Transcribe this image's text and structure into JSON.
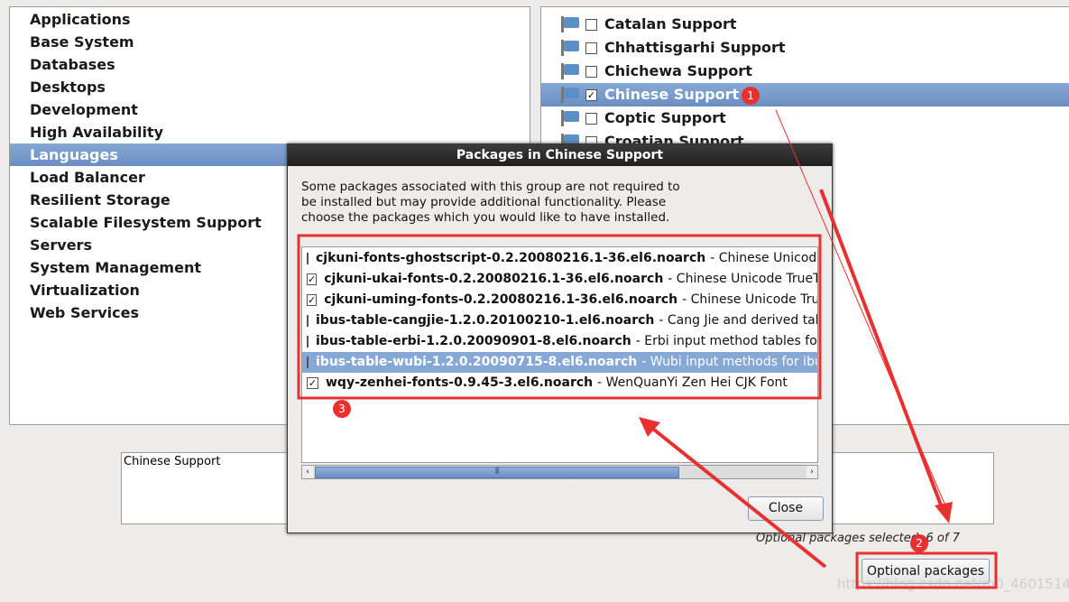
{
  "groups": [
    "Applications",
    "Base System",
    "Databases",
    "Desktops",
    "Development",
    "High Availability",
    "Languages",
    "Load Balancer",
    "Resilient Storage",
    "Scalable Filesystem Support",
    "Servers",
    "System Management",
    "Virtualization",
    "Web Services"
  ],
  "selected_group": "Languages",
  "languages": [
    {
      "label": "Catalan Support",
      "checked": false
    },
    {
      "label": "Chhattisgarhi Support",
      "checked": false
    },
    {
      "label": "Chichewa Support",
      "checked": false
    },
    {
      "label": "Chinese Support",
      "checked": true,
      "selected": true
    },
    {
      "label": "Coptic Support",
      "checked": false
    },
    {
      "label": "Croatian Support",
      "checked": false
    }
  ],
  "description": "Chinese Support",
  "count_text": "Optional packages selected: 6 of 7",
  "optional_button": "Optional packages",
  "dialog": {
    "title": "Packages in Chinese Support",
    "text": "Some packages associated with this group are not required to be installed but may provide additional functionality. Please choose the packages which you would like to have installed.",
    "close": "Close",
    "packages": [
      {
        "name": "cjkuni-fonts-ghostscript-0.2.20080216.1-36.el6.noarch",
        "desc": "- Chinese Unicode TrueType fonts",
        "checked": false
      },
      {
        "name": "cjkuni-ukai-fonts-0.2.20080216.1-36.el6.noarch",
        "desc": "- Chinese Unicode TrueType fonts",
        "checked": true
      },
      {
        "name": "cjkuni-uming-fonts-0.2.20080216.1-36.el6.noarch",
        "desc": "- Chinese Unicode TrueType fonts",
        "checked": true
      },
      {
        "name": "ibus-table-cangjie-1.2.0.20100210-1.el6.noarch",
        "desc": "- Cang Jie and derived tables",
        "checked": false
      },
      {
        "name": "ibus-table-erbi-1.2.0.20090901-8.el6.noarch",
        "desc": "- Erbi input method tables for IBus",
        "checked": false
      },
      {
        "name": "ibus-table-wubi-1.2.0.20090715-8.el6.noarch",
        "desc": "- Wubi input methods for ibus-table",
        "checked": false,
        "selected": true
      },
      {
        "name": "wqy-zenhei-fonts-0.9.45-3.el6.noarch",
        "desc": "- WenQuanYi Zen Hei CJK Font",
        "checked": true
      }
    ]
  },
  "annotations": [
    "1",
    "2",
    "3"
  ],
  "watermark": "https://blog.csdn.net/m0_46015143",
  "colors": {
    "selection": "#86a8d6",
    "annotation": "#e8302f"
  }
}
